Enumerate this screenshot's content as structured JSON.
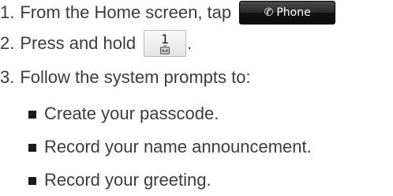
{
  "steps": [
    {
      "number": "1.",
      "text": "From the Home screen, tap",
      "button_label": "Phone",
      "button_icon": "phone-handset-icon"
    },
    {
      "number": "2.",
      "text": "Press and hold",
      "key_digit": "1",
      "key_icon": "voicemail-icon",
      "suffix": "."
    },
    {
      "number": "3.",
      "text": "Follow the system prompts to:"
    }
  ],
  "sub_steps": [
    "Create your passcode.",
    "Record your name announcement.",
    "Record your greeting."
  ],
  "colors": {
    "text": "#3c3c3c",
    "button_background": "#1a1a1a",
    "button_text": "#ffffff"
  }
}
